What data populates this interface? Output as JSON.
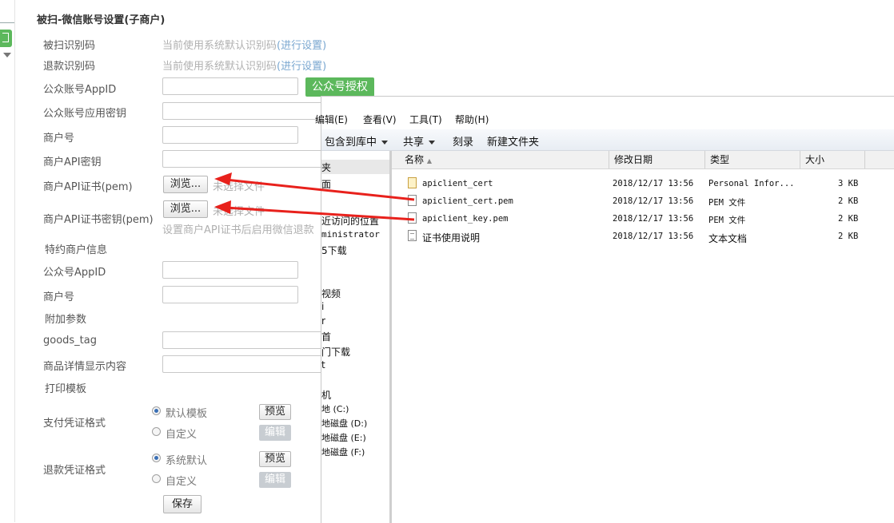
{
  "page_title": "被扫-微信账号设置(子商户)",
  "form": {
    "scan_code_label": "被扫识别码",
    "scan_code_hint": "当前使用系统默认识别码",
    "scan_code_link": "(进行设置)",
    "refund_code_label": "退款识别码",
    "refund_code_hint": "当前使用系统默认识别码",
    "refund_code_link": "(进行设置)",
    "appid_label": "公众账号AppID",
    "wx_auth_button": "公众号授权",
    "app_secret_label": "公众账号应用密钥",
    "merchant_no_label": "商户号",
    "api_key_label": "商户API密钥",
    "api_cert_label": "商户API证书(pem)",
    "browse_label": "浏览...",
    "no_file_text": "未选择文件",
    "api_cert_key_label": "商户API证书密钥(pem)",
    "cert_hint": "设置商户API证书后启用微信退款",
    "special_merchant_title": "特约商户信息",
    "sp_appid_label": "公众号AppID",
    "sp_merchant_no_label": "商户号",
    "extra_params_title": "附加参数",
    "goods_tag_label": "goods_tag",
    "goods_detail_label": "商品详情显示内容",
    "print_template_title": "打印模板",
    "pay_voucher_label": "支付凭证格式",
    "pay_default_option": "默认模板",
    "pay_custom_option": "自定义",
    "refund_voucher_label": "退款凭证格式",
    "refund_default_option": "系统默认",
    "refund_custom_option": "自定义",
    "preview_label": "预览",
    "edit_label": "编辑",
    "save_label": "保存"
  },
  "explorer": {
    "menu": [
      "编辑(E)",
      "查看(V)",
      "工具(T)",
      "帮助(H)"
    ],
    "toolbar": {
      "include_library": "包含到库中",
      "share": "共享",
      "burn": "刻录",
      "new_folder": "新建文件夹"
    },
    "nav": [
      "夹",
      "面",
      "近访问的位置",
      "ministrator",
      "5下载",
      "视频",
      "i",
      "r",
      "首",
      "门下载",
      "t",
      "机",
      "地 (C:)",
      "地磁盘 (D:)",
      "地磁盘 (E:)",
      "地磁盘 (F:)"
    ],
    "columns": [
      "名称",
      "修改日期",
      "类型",
      "大小"
    ],
    "files": [
      {
        "name": "apiclient_cert",
        "date": "2018/12/17 13:56",
        "type": "Personal Infor...",
        "size": "3 KB",
        "icon": "certificate-icon"
      },
      {
        "name": "apiclient_cert.pem",
        "date": "2018/12/17 13:56",
        "type": "PEM 文件",
        "size": "2 KB",
        "icon": "file-icon"
      },
      {
        "name": "apiclient_key.pem",
        "date": "2018/12/17 13:56",
        "type": "PEM 文件",
        "size": "2 KB",
        "icon": "file-icon"
      },
      {
        "name": "证书使用说明",
        "date": "2018/12/17 13:56",
        "type": "文本文档",
        "size": "2 KB",
        "icon": "text-file-icon"
      }
    ]
  },
  "colors": {
    "accent_green": "#5cb85c",
    "arrow_red": "#e8211c",
    "link_blue": "#7aa7d0"
  }
}
